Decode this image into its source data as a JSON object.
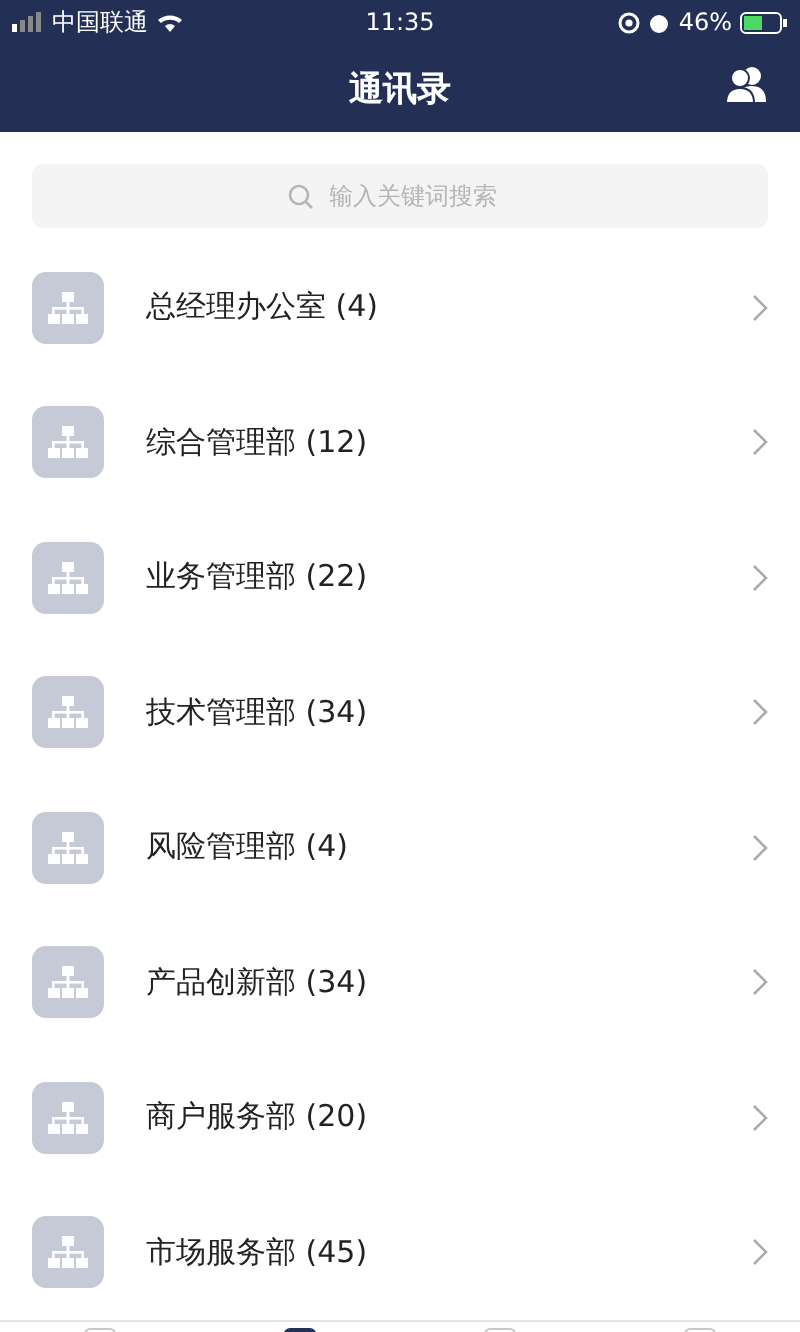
{
  "status_bar": {
    "carrier": "中国联通",
    "time": "11:35",
    "battery": "46%"
  },
  "header": {
    "title": "通讯录"
  },
  "search": {
    "placeholder": "输入关键词搜索"
  },
  "departments": [
    {
      "name": "总经理办公室 (4)"
    },
    {
      "name": "综合管理部 (12)"
    },
    {
      "name": "业务管理部 (22)"
    },
    {
      "name": "技术管理部 (34)"
    },
    {
      "name": "风险管理部 (4)"
    },
    {
      "name": "产品创新部 (34)"
    },
    {
      "name": "商户服务部 (20)"
    },
    {
      "name": "市场服务部 (45)"
    }
  ],
  "tab_bar": [
    {
      "selected": false
    },
    {
      "selected": true
    },
    {
      "selected": false
    },
    {
      "selected": false
    }
  ]
}
